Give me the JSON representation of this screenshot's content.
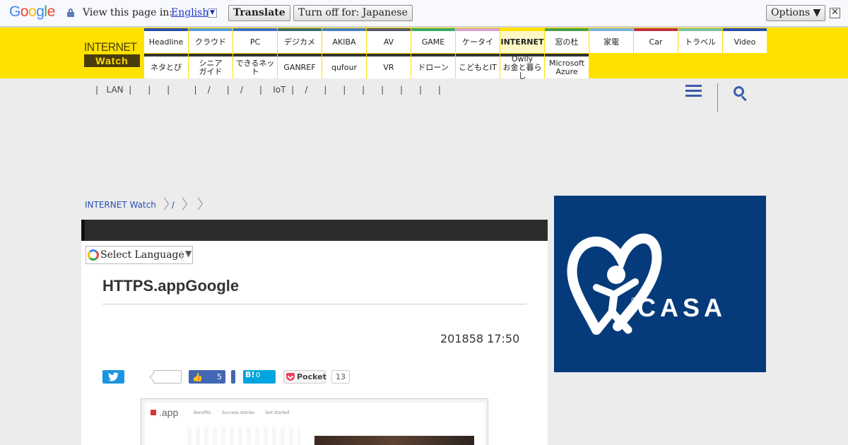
{
  "translate_bar": {
    "logo_letters": [
      {
        "ch": "G",
        "color": "#4285f4"
      },
      {
        "ch": "o",
        "color": "#ea4335"
      },
      {
        "ch": "o",
        "color": "#fbbc05"
      },
      {
        "ch": "g",
        "color": "#4285f4"
      },
      {
        "ch": "l",
        "color": "#34a853"
      },
      {
        "ch": "e",
        "color": "#ea4335"
      }
    ],
    "prompt": "View this page in:",
    "language": "English",
    "translate_label": "Translate",
    "turn_off_label": "Turn off for: Japanese",
    "options_label": "Options ▼",
    "close_glyph": "✕"
  },
  "site": {
    "logo_top": "INTERNET",
    "logo_bottom": "Watch",
    "nav_row1": [
      {
        "label": "Headline",
        "color": "#2b4ea8"
      },
      {
        "label": "クラウド",
        "color": "#5b9bd5"
      },
      {
        "label": "PC",
        "color": "#3e6fc2"
      },
      {
        "label": "デジカメ",
        "color": "#3a6e6e"
      },
      {
        "label": "AKIBA",
        "color": "#4a7fc0"
      },
      {
        "label": "AV",
        "color": "#555a64"
      },
      {
        "label": "GAME",
        "color": "#3aaa6a"
      },
      {
        "label": "ケータイ",
        "color": "#d8a0d0"
      },
      {
        "label": "INTERNET",
        "color": "#ffe100",
        "active": true
      },
      {
        "label": "窓の杜",
        "color": "#4aa04a"
      },
      {
        "label": "家電",
        "color": "#7ab0e0"
      },
      {
        "label": "Car",
        "color": "#c03040"
      },
      {
        "label": "トラベル",
        "color": "#7ac0a0"
      },
      {
        "label": "Video",
        "color": "#2b4ea8"
      }
    ],
    "nav_row2": [
      {
        "label": "ネタとぴ",
        "color": "#333"
      },
      {
        "label": "シニア\nガイド",
        "color": "#333"
      },
      {
        "label": "できるネット",
        "color": "#333"
      },
      {
        "label": "GANREF",
        "color": "#333"
      },
      {
        "label": "qufour",
        "color": "#333"
      },
      {
        "label": "VR",
        "color": "#333"
      },
      {
        "label": "ドローン",
        "color": "#333"
      },
      {
        "label": "こどもとIT",
        "color": "#333"
      },
      {
        "label": "Owlly\nお金と暮らし",
        "color": "#333"
      },
      {
        "label": "Microsoft\nAzure",
        "color": "#333"
      }
    ],
    "sub_links": "|   LAN  |      |      |         |    /      |    /      |    IoT  |    /      |      |      |      |      |      |      |"
  },
  "breadcrumb": {
    "home": "INTERNET Watch",
    "slash": "/"
  },
  "article": {
    "select_language": "Select Language",
    "select_arrow": "▼",
    "title": "HTTPS.appGoogle",
    "date": "201858 17:50",
    "share": {
      "facebook_count": "5",
      "hatena_label": "B!",
      "hatena_count": "0",
      "pocket_label": "Pocket",
      "pocket_count": "13"
    },
    "screenshot": {
      "logo": ".app",
      "nav": "Benefits        Success stories        Get started"
    }
  },
  "ad": {
    "brand": "CASA",
    "reg_mark": "®"
  }
}
